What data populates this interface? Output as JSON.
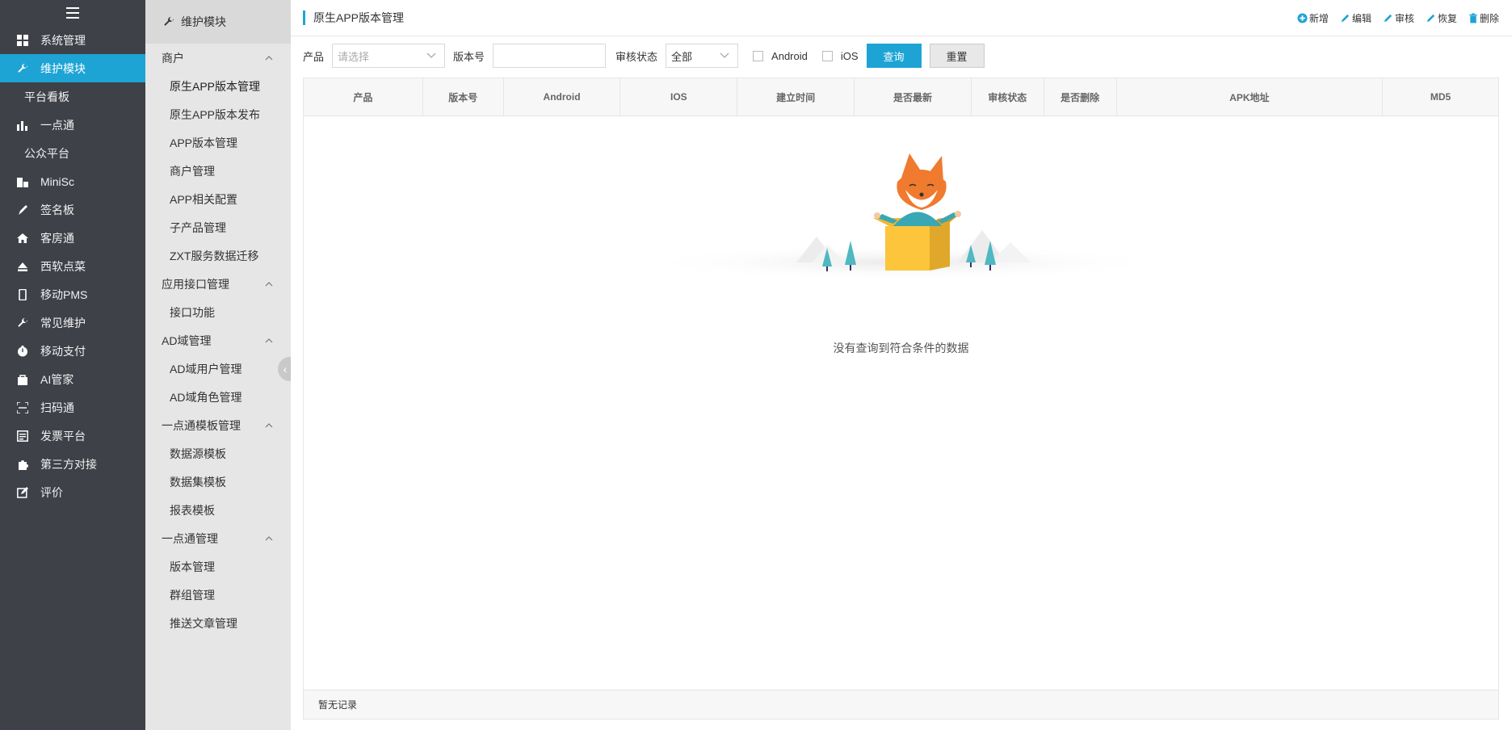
{
  "sidebar": {
    "items": [
      {
        "label": "系统管理",
        "icon": "grid-icon"
      },
      {
        "label": "维护模块",
        "icon": "wrench-icon",
        "active": true
      },
      {
        "label": "平台看板",
        "sub": true
      },
      {
        "label": "一点通",
        "icon": "bar-chart-icon"
      },
      {
        "label": "公众平台",
        "sub": true
      },
      {
        "label": "MiniSc",
        "icon": "building-icon"
      },
      {
        "label": "签名板",
        "icon": "pen-icon"
      },
      {
        "label": "客房通",
        "icon": "home-icon"
      },
      {
        "label": "西软点菜",
        "icon": "eject-icon"
      },
      {
        "label": "移动PMS",
        "icon": "mobile-icon"
      },
      {
        "label": "常见维护",
        "icon": "wrench-icon"
      },
      {
        "label": "移动支付",
        "icon": "clock-icon"
      },
      {
        "label": "AI管家",
        "icon": "bag-icon"
      },
      {
        "label": "扫码通",
        "icon": "scan-icon"
      },
      {
        "label": "发票平台",
        "icon": "list-icon"
      },
      {
        "label": "第三方对接",
        "icon": "puzzle-icon"
      },
      {
        "label": "评价",
        "icon": "edit-icon"
      }
    ]
  },
  "subnav": {
    "title": "维护模块",
    "groups": [
      {
        "label": "商户",
        "links": [
          "原生APP版本管理",
          "原生APP版本发布",
          "APP版本管理",
          "商户管理",
          "APP相关配置",
          "子产品管理",
          "ZXT服务数据迁移"
        ]
      },
      {
        "label": "应用接口管理",
        "links": [
          "接口功能"
        ]
      },
      {
        "label": "AD域管理",
        "links": [
          "AD域用户管理",
          "AD域角色管理"
        ]
      },
      {
        "label": "一点通模板管理",
        "links": [
          "数据源模板",
          "数据集模板",
          "报表模板"
        ]
      },
      {
        "label": "一点通管理",
        "links": [
          "版本管理",
          "群组管理",
          "推送文章管理"
        ]
      }
    ]
  },
  "page": {
    "title": "原生APP版本管理",
    "actions": {
      "add": "新增",
      "edit": "编辑",
      "audit": "审核",
      "restore": "恢复",
      "delete": "删除"
    }
  },
  "filter": {
    "product_label": "产品",
    "product_placeholder": "请选择",
    "version_label": "版本号",
    "version_value": "",
    "status_label": "审核状态",
    "status_value": "全部",
    "android_label": "Android",
    "ios_label": "iOS",
    "query_label": "查询",
    "reset_label": "重置"
  },
  "table": {
    "columns": [
      "产品",
      "版本号",
      "Android",
      "IOS",
      "建立时间",
      "是否最新",
      "审核状态",
      "是否删除",
      "APK地址",
      "MD5"
    ],
    "empty_text": "没有查询到符合条件的数据",
    "footer": "暂无记录"
  },
  "colors": {
    "accent": "#1ea4d4",
    "sidebar_bg": "#3f4149",
    "subnav_bg": "#e6e6e6"
  }
}
